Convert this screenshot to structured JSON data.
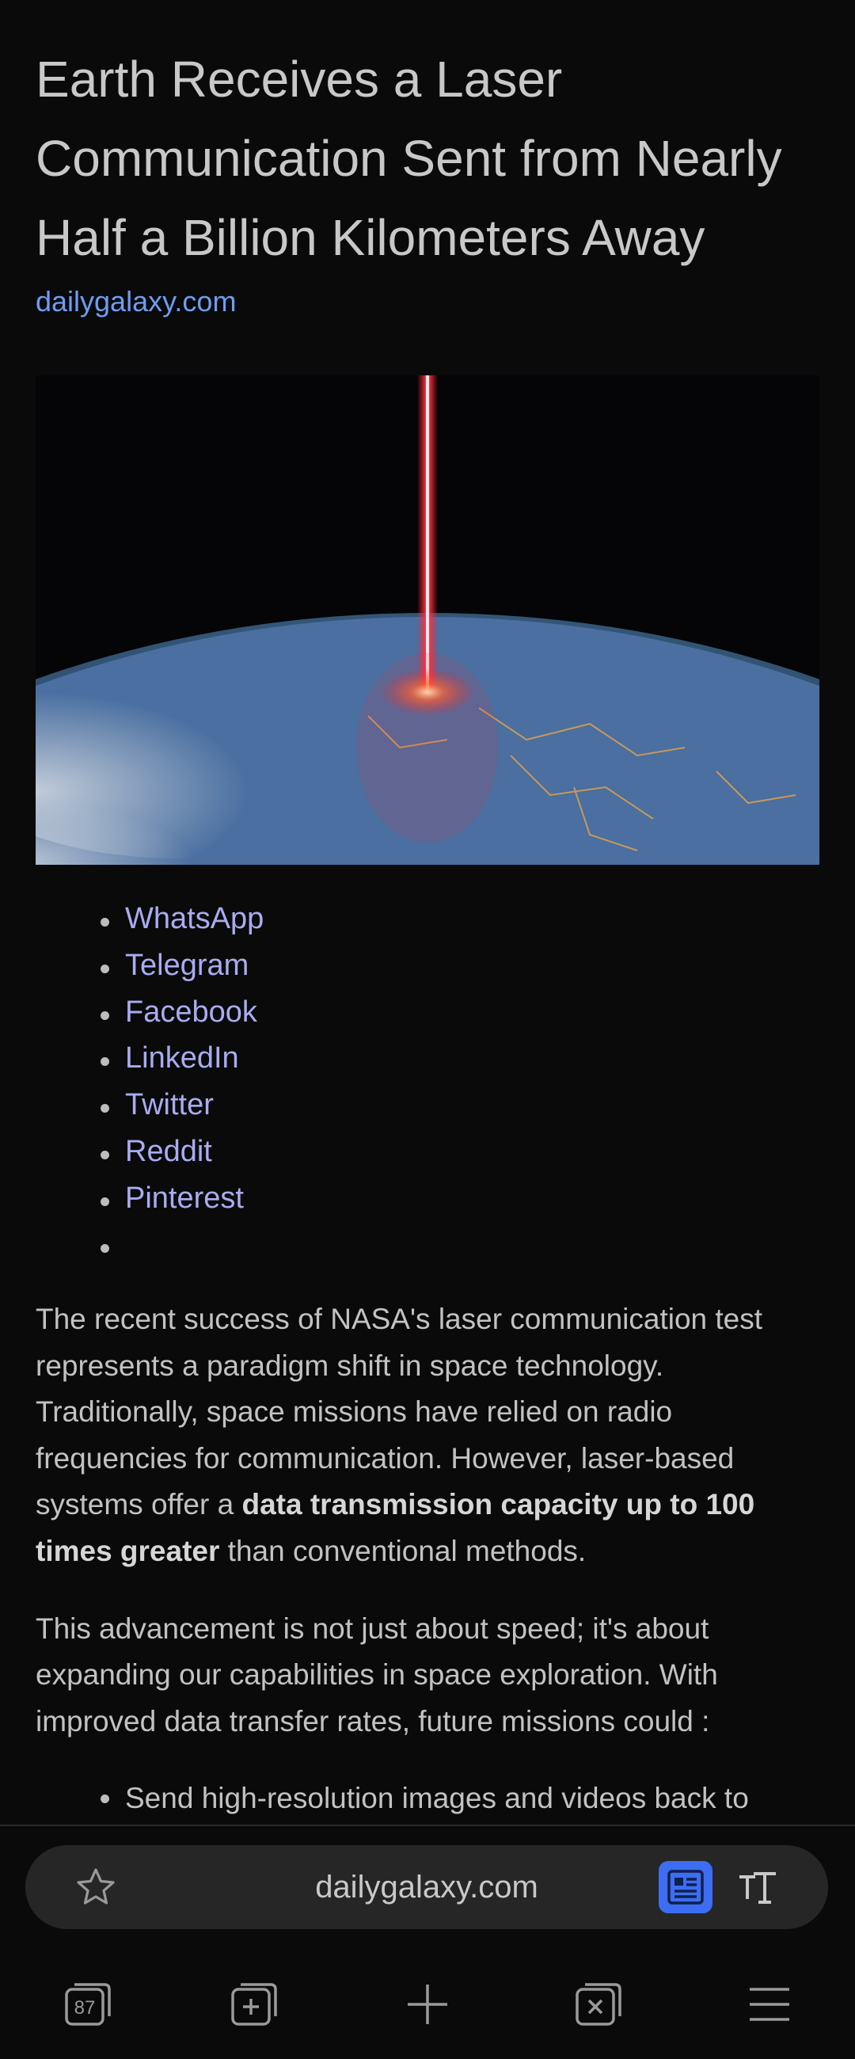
{
  "article": {
    "title": "Earth Receives a Laser Communication Sent from Nearly Half a Billion Kilometers Away",
    "source": "dailygalaxy.com",
    "hero_image": "earth-from-orbit-with-red-laser-beam"
  },
  "share_links": [
    "WhatsApp",
    "Telegram",
    "Facebook",
    "LinkedIn",
    "Twitter",
    "Reddit",
    "Pinterest",
    ""
  ],
  "paragraphs": {
    "p1_part1": "The recent success of NASA's laser communication test represents a paradigm shift in space technology. Traditionally, space missions have relied on radio frequencies for communication. However, laser-based systems offer a ",
    "p1_bold": "data transmission capacity up to 100 times greater",
    "p1_part2": " than conventional methods.",
    "p2": "This advancement is not just about speed; it's about expanding our capabilities in space exploration. With improved data transfer rates, future missions could :"
  },
  "bullets": [
    "Send high-resolution images and videos back to"
  ],
  "browser": {
    "url": "dailygalaxy.com",
    "tab_count": "87",
    "icons": {
      "bookmark": "star-icon",
      "reader": "reader-mode-icon",
      "text_size": "text-size-icon",
      "tabs": "tabs-icon",
      "add_tab": "new-tab-icon",
      "plus": "plus-icon",
      "close_tab": "close-tab-icon",
      "menu": "menu-icon"
    },
    "accent": "#3d6df2"
  }
}
